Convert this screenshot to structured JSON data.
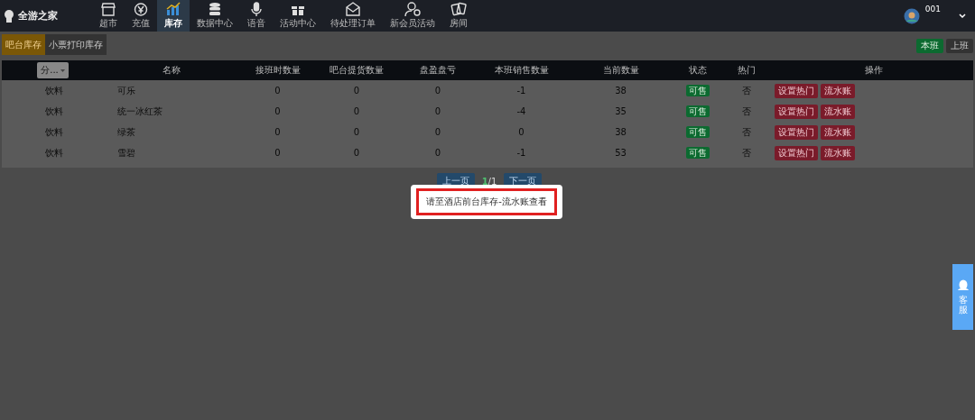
{
  "logo": {
    "text": "全游之家"
  },
  "nav": [
    {
      "label": "超市",
      "selected": false
    },
    {
      "label": "充值",
      "selected": false
    },
    {
      "label": "库存",
      "selected": true
    },
    {
      "label": "数据中心",
      "selected": false
    },
    {
      "label": "语音",
      "selected": false
    },
    {
      "label": "活动中心",
      "selected": false
    },
    {
      "label": "待处理订单",
      "selected": false
    },
    {
      "label": "新会员活动",
      "selected": false
    },
    {
      "label": "房间",
      "selected": false
    }
  ],
  "user": {
    "name": "001"
  },
  "tabs": [
    {
      "label": "吧台库存",
      "selected": true
    },
    {
      "label": "小票打印库存",
      "selected": false
    }
  ],
  "shift_buttons": [
    {
      "label": "本班",
      "selected": true
    },
    {
      "label": "上班",
      "selected": false
    }
  ],
  "table": {
    "category_filter": "分...",
    "columns": [
      "名称",
      "接班时数量",
      "吧台提货数量",
      "盘盈盘亏",
      "本班销售数量",
      "当前数量",
      "状态",
      "热门",
      "操作"
    ],
    "rows": [
      {
        "category": "饮料",
        "name": "可乐",
        "start": "0",
        "pickup": "0",
        "diff": "0",
        "sold": "-1",
        "current": "38",
        "status": "可售",
        "hot": "否",
        "actions": [
          "设置热门",
          "流水账"
        ]
      },
      {
        "category": "饮料",
        "name": "统一冰红茶",
        "start": "0",
        "pickup": "0",
        "diff": "0",
        "sold": "-4",
        "current": "35",
        "status": "可售",
        "hot": "否",
        "actions": [
          "设置热门",
          "流水账"
        ]
      },
      {
        "category": "饮料",
        "name": "绿茶",
        "start": "0",
        "pickup": "0",
        "diff": "0",
        "sold": "0",
        "current": "38",
        "status": "可售",
        "hot": "否",
        "actions": [
          "设置热门",
          "流水账"
        ]
      },
      {
        "category": "饮料",
        "name": "雪碧",
        "start": "0",
        "pickup": "0",
        "diff": "0",
        "sold": "-1",
        "current": "53",
        "status": "可售",
        "hot": "否",
        "actions": [
          "设置热门",
          "流水账"
        ]
      }
    ]
  },
  "pagination": {
    "prev": "上一页",
    "current": "1",
    "total": "/1",
    "next": "下一页"
  },
  "dialog": {
    "message": "请至酒店前台库存-流水账查看"
  },
  "service_button": {
    "label": "客服"
  }
}
